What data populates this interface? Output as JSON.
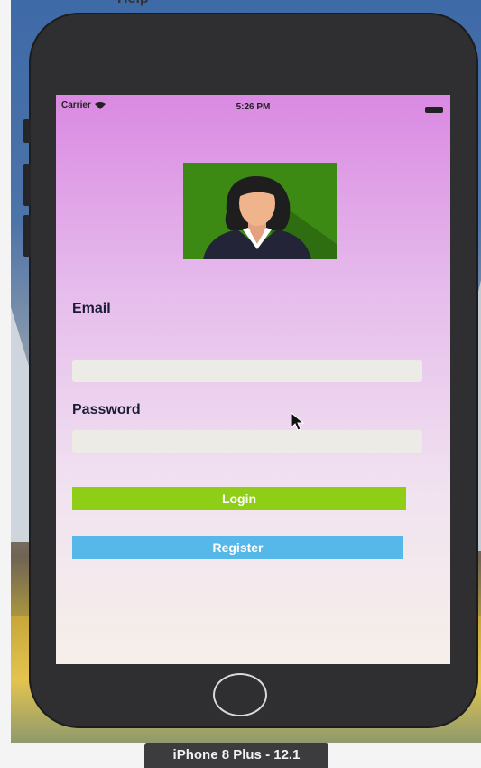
{
  "menu": {
    "help_text": "Help"
  },
  "status_bar": {
    "carrier": "Carrier",
    "time": "5:26 PM"
  },
  "form": {
    "email_label": "Email",
    "email_value": "",
    "password_label": "Password",
    "password_value": "",
    "login_label": "Login",
    "register_label": "Register"
  },
  "device_label": "iPhone 8 Plus - 12.1",
  "icons": {
    "wifi": "wifi-icon",
    "battery": "battery-icon",
    "avatar": "avatar-image",
    "cursor": "cursor-icon"
  },
  "colors": {
    "login_button": "#8fce16",
    "register_button": "#56b8e8",
    "avatar_background": "#3c8a14",
    "screen_top": "#da89e2"
  }
}
